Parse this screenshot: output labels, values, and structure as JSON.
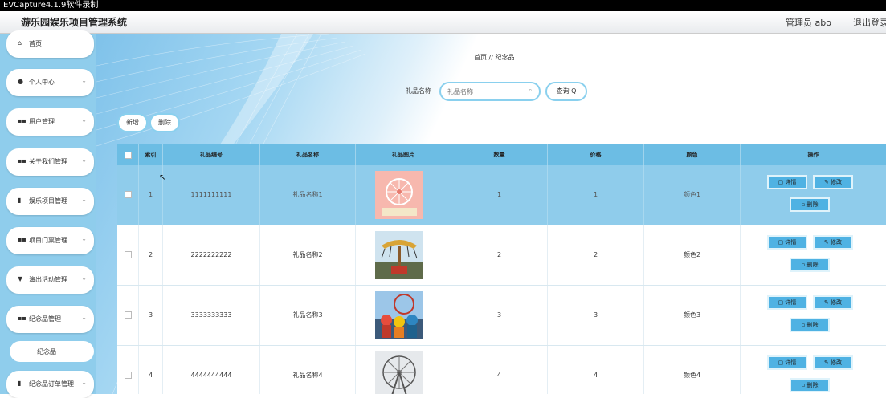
{
  "recorder": {
    "title": "EVCapture4.1.9软件录制"
  },
  "header": {
    "app_title": "游乐园娱乐项目管理系统",
    "admin": "管理员 abo",
    "logout": "退出登录"
  },
  "sidebar": {
    "items": [
      {
        "icon": "home-icon",
        "label": "首页",
        "chevron": false
      },
      {
        "icon": "user-icon",
        "label": "个人中心",
        "chevron": true
      },
      {
        "icon": "grid-icon",
        "label": "用户管理",
        "chevron": true
      },
      {
        "icon": "grid-icon",
        "label": "关于我们管理",
        "chevron": true
      },
      {
        "icon": "lock-icon",
        "label": "娱乐项目管理",
        "chevron": true
      },
      {
        "icon": "grid-icon",
        "label": "项目门票管理",
        "chevron": true
      },
      {
        "icon": "bookmark-icon",
        "label": "演出活动管理",
        "chevron": true
      },
      {
        "icon": "grid-icon",
        "label": "纪念品管理",
        "chevron": true
      },
      {
        "icon": "lock-icon",
        "label": "纪念品订单管理",
        "chevron": true
      }
    ],
    "sub_item": "纪念品"
  },
  "breadcrumb": {
    "home": "首页",
    "sep": "//",
    "current": "纪念品"
  },
  "search": {
    "label": "礼品名称",
    "placeholder": "礼品名称",
    "button": "查询"
  },
  "toolbar": {
    "add": "新增",
    "delete": "删除"
  },
  "table": {
    "columns": [
      "索引",
      "礼品编号",
      "礼品名称",
      "礼品图片",
      "数量",
      "价格",
      "颜色",
      "操作"
    ],
    "rows": [
      {
        "index": "1",
        "code": "1111111111",
        "name": "礼品名称1",
        "qty": "1",
        "price": "1",
        "color": "颜色1"
      },
      {
        "index": "2",
        "code": "2222222222",
        "name": "礼品名称2",
        "qty": "2",
        "price": "2",
        "color": "颜色2"
      },
      {
        "index": "3",
        "code": "3333333333",
        "name": "礼品名称3",
        "qty": "3",
        "price": "3",
        "color": "颜色3"
      },
      {
        "index": "4",
        "code": "4444444444",
        "name": "礼品名称4",
        "qty": "4",
        "price": "4",
        "color": "颜色4"
      }
    ],
    "actions": {
      "detail": "详情",
      "edit": "修改",
      "delete": "删除"
    }
  }
}
